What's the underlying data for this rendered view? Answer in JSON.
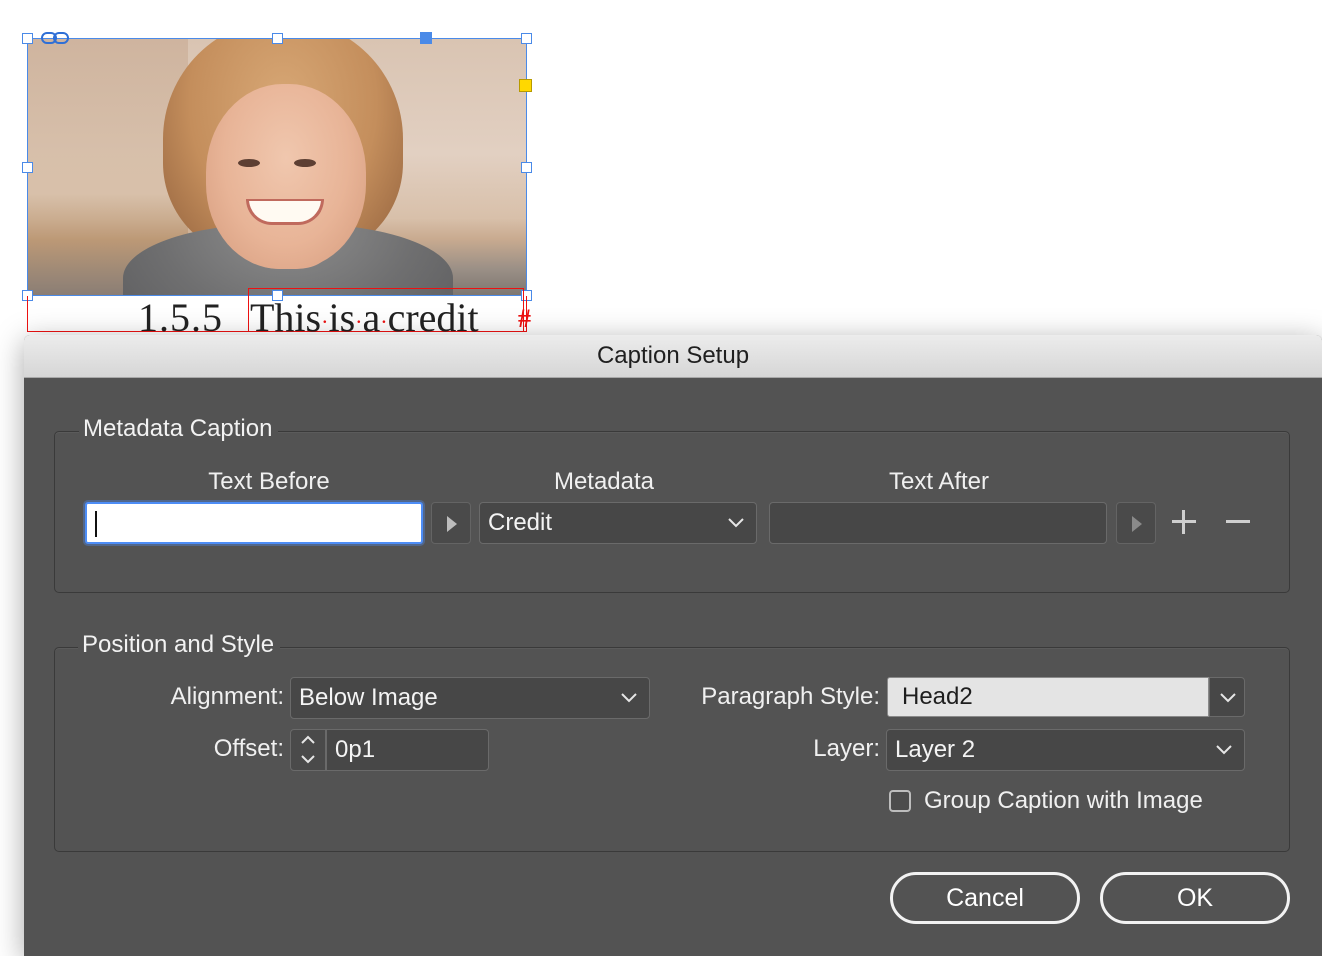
{
  "canvas": {
    "caption_number": "1.5.5",
    "caption_words": [
      "This",
      "is",
      "a",
      "credit"
    ],
    "caption_separator": "·",
    "end_mark": "#"
  },
  "dialog": {
    "title": "Caption Setup",
    "metadata_caption": {
      "group_title": "Metadata Caption",
      "col_text_before": "Text Before",
      "col_metadata": "Metadata",
      "col_text_after": "Text After",
      "text_before_value": "",
      "metadata_value": "Credit",
      "text_after_value": ""
    },
    "position_style": {
      "group_title": "Position and Style",
      "alignment_label": "Alignment:",
      "alignment_value": "Below Image",
      "offset_label": "Offset:",
      "offset_value": "0p1",
      "paragraph_style_label": "Paragraph Style:",
      "paragraph_style_value": "Head2",
      "layer_label": "Layer:",
      "layer_value": "Layer 2",
      "group_caption_label": "Group Caption with Image",
      "group_caption_checked": false
    },
    "buttons": {
      "cancel": "Cancel",
      "ok": "OK"
    }
  },
  "colors": {
    "dialog_bg": "#535353",
    "focus_ring": "#4d8df6",
    "selection_frame": "#4a8ae8",
    "caption_frame": "#ee1111",
    "handle_yellow": "#ffd800"
  },
  "icons": [
    "link-icon",
    "play-triangle-icon",
    "plus-icon",
    "minus-icon",
    "chevron-down-icon",
    "chevron-up-icon"
  ]
}
